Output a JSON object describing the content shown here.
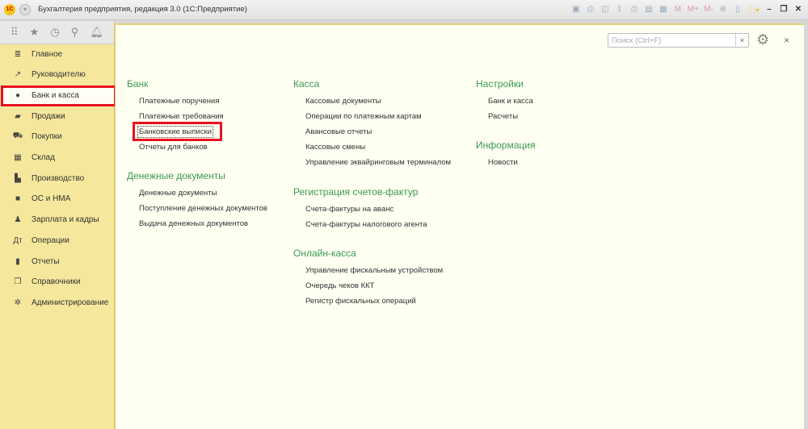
{
  "window": {
    "title": "Бухгалтерия предприятия, редакция 3.0  (1С:Предприятие)",
    "logo": "1С"
  },
  "toolbar": [
    "save-icon",
    "print-icon",
    "preview-icon",
    "upload-icon",
    "print2-icon",
    "calculator-icon",
    "calendar-icon"
  ],
  "memory": [
    "M",
    "M+",
    "M-"
  ],
  "sidebar": {
    "items": [
      {
        "label": "Главное",
        "icon": "≣"
      },
      {
        "label": "Руководителю",
        "icon": "↗"
      },
      {
        "label": "Банк и касса",
        "icon": "●"
      },
      {
        "label": "Продажи",
        "icon": "▰"
      },
      {
        "label": "Покупки",
        "icon": "⛟"
      },
      {
        "label": "Склад",
        "icon": "▦"
      },
      {
        "label": "Производство",
        "icon": "▙"
      },
      {
        "label": "ОС и НМА",
        "icon": "■"
      },
      {
        "label": "Зарплата и кадры",
        "icon": "♟"
      },
      {
        "label": "Операции",
        "icon": "Дт"
      },
      {
        "label": "Отчеты",
        "icon": "▮"
      },
      {
        "label": "Справочники",
        "icon": "❐"
      },
      {
        "label": "Администрирование",
        "icon": "✲"
      }
    ]
  },
  "search": {
    "placeholder": "Поиск (Ctrl+F)",
    "clear": "×"
  },
  "close": "×",
  "sections": {
    "bank": {
      "title": "Банк",
      "items": [
        "Платежные поручения",
        "Платежные требования",
        "Банковские выписки",
        "Отчеты для банков"
      ]
    },
    "money_docs": {
      "title": "Денежные документы",
      "items": [
        "Денежные документы",
        "Поступление денежных документов",
        "Выдача денежных документов"
      ]
    },
    "kassa": {
      "title": "Касса",
      "items": [
        "Кассовые документы",
        "Операции по платежным картам",
        "Авансовые отчеты",
        "Кассовые смены",
        "Управление эквайринговым терминалом"
      ]
    },
    "invoices": {
      "title": "Регистрация счетов-фактур",
      "items": [
        "Счета-фактуры на аванс",
        "Счета-фактуры налогового агента"
      ]
    },
    "online": {
      "title": "Онлайн-касса",
      "items": [
        "Управление фискальным устройством",
        "Очередь чеков ККТ",
        "Регистр фискальных операций"
      ]
    },
    "settings": {
      "title": "Настройки",
      "items": [
        "Банк и касса",
        "Расчеты"
      ]
    },
    "info": {
      "title": "Информация",
      "items": [
        "Новости"
      ]
    }
  }
}
